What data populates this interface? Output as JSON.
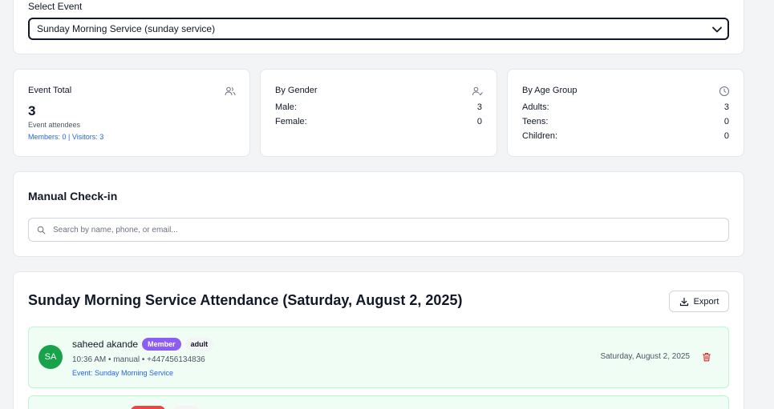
{
  "select_event": {
    "label": "Select Event",
    "selected": "Sunday Morning Service (sunday service)"
  },
  "stats": {
    "total": {
      "title": "Event Total",
      "value": "3",
      "subtitle": "Event attendees",
      "breakdown": "Members: 0 | Visitors: 3"
    },
    "gender": {
      "title": "By Gender",
      "rows": [
        {
          "label": "Male:",
          "value": "3"
        },
        {
          "label": "Female:",
          "value": "0"
        }
      ]
    },
    "age": {
      "title": "By Age Group",
      "rows": [
        {
          "label": "Adults:",
          "value": "3"
        },
        {
          "label": "Teens:",
          "value": "0"
        },
        {
          "label": "Children:",
          "value": "0"
        }
      ]
    }
  },
  "checkin": {
    "title": "Manual Check-in",
    "search_placeholder": "Search by name, phone, or email..."
  },
  "attendance": {
    "title": "Sunday Morning Service Attendance (Saturday, August 2, 2025)",
    "export_label": "Export",
    "records": [
      {
        "initials": "SA",
        "name": "saheed akande",
        "type_badge": "Member",
        "age_badge": "adult",
        "meta": "10:36 AM • manual • +447456134836",
        "event": "Event: Sunday Morning Service",
        "date": "Saturday, August 2, 2025"
      }
    ]
  },
  "colors": {
    "accent_blue": "#2563eb",
    "member_badge": "#8b5cf6",
    "avatar_green": "#16a34a",
    "row_bg": "#f0fdf4",
    "delete_red": "#dc2626"
  },
  "icons": [
    "chevron-down-icon",
    "users-icon",
    "user-check-icon",
    "clock-icon",
    "search-icon",
    "download-icon",
    "trash-icon"
  ]
}
